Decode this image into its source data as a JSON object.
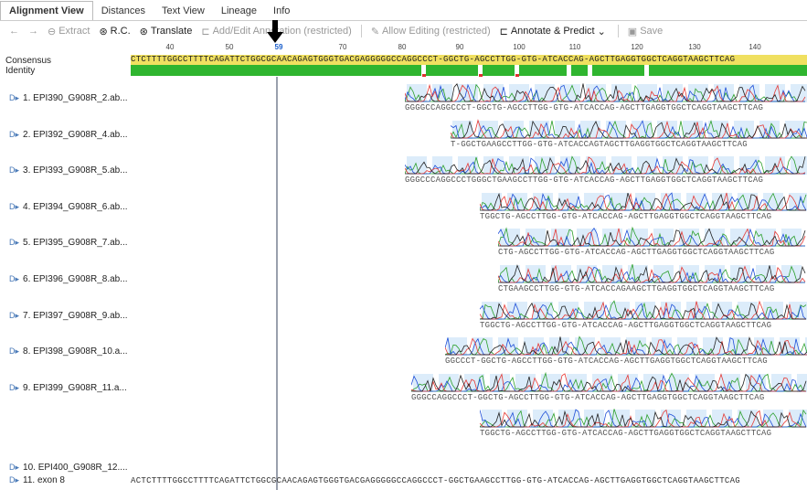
{
  "tabs": [
    {
      "label": "Alignment View",
      "active": true
    },
    {
      "label": "Distances"
    },
    {
      "label": "Text View"
    },
    {
      "label": "Lineage"
    },
    {
      "label": "Info"
    }
  ],
  "toolbar": {
    "back": "←",
    "forward": "→",
    "extract": "Extract",
    "rc": "R.C.",
    "translate": "Translate",
    "add_edit_annotation": "Add/Edit Annotation (restricted)",
    "allow_editing": "Allow Editing (restricted)",
    "annotate_predict": "Annotate & Predict",
    "save": "Save"
  },
  "ruler": {
    "ticks": [
      "40",
      "50",
      "59",
      "70",
      "80",
      "90",
      "100",
      "110",
      "120",
      "130",
      "140"
    ],
    "highlight": "59"
  },
  "header": {
    "consensus_label": "Consensus",
    "identity_label": "Identity",
    "consensus_seq": "CTCTTTTGGCCTTTTCAGATTCTGGCGCAACAGAGTGGGTGACGAGGGGGCCAGGCCCT-GGCTG-AGCCTTGG-GTG-ATCACCAG-AGCTTGAGGTGGCTCAGGTAAGCTTCAG"
  },
  "tracks": [
    {
      "label": "1. EPI390_G908R_2.ab...",
      "seq": "GGGGCCAGGCCCT-GGCTG-AGCCTTGG-GTG-ATCACCAG-AGCTTGAGGTGGCTCAGGTAAGCTTCAG"
    },
    {
      "label": "2. EPI392_G908R_4.ab...",
      "seq": "T-GGCTGAAGCCTTGG-GTG-ATCACCAGTAGCTTGAGGTGGCTCAGGTAAGCTTCAG"
    },
    {
      "label": "3. EPI393_G908R_5.ab...",
      "seq": "GGGCCCAGGCCCTGGGCTGAAGCCTTGG-GTG-ATCACCAG-AGCTTGAGGTGGCTCAGGTAAGCTTCAG"
    },
    {
      "label": "4. EPI394_G908R_6.ab...",
      "seq": "TGGCTG-AGCCTTGG-GTG-ATCACCAG-AGCTTGAGGTGGCTCAGGTAAGCTTCAG"
    },
    {
      "label": "5. EPI395_G908R_7.ab...",
      "seq": "CTG-AGCCTTGG-GTG-ATCACCAG-AGCTTGAGGTGGCTCAGGTAAGCTTCAG"
    },
    {
      "label": "6. EPI396_G908R_8.ab...",
      "seq": "CTGAAGCCTTGG-GTG-ATCACCAGAAGCTTGAGGTGGCTCAGGTAAGCTTCAG"
    },
    {
      "label": "7. EPI397_G908R_9.ab...",
      "seq": "TGGCTG-AGCCTTGG-GTG-ATCACCAG-AGCTTGAGGTGGCTCAGGTAAGCTTCAG"
    },
    {
      "label": "8. EPI398_G908R_10.a...",
      "seq": "GGCCCT-GGCTG-AGCCTTGG-GTG-ATCACCAG-AGCTTGAGGTGGCTCAGGTAAGCTTCAG"
    },
    {
      "label": "9. EPI399_G908R_11.a...",
      "seq": "GGGCCAGGCCCT-GGCTG-AGCCTTGG-GTG-ATCACCAG-AGCTTGAGGTGGCTCAGGTAAGCTTCAG"
    },
    {
      "label": "10. EPI400_G908R_12....",
      "seq": "TGGCTG-AGCCTTGG-GTG-ATCACCAG-AGCTTGAGGTGGCTCAGGTAAGCTTCAG"
    }
  ],
  "exon": {
    "label": "11. exon 8",
    "seq": "ACTCTTTTGGCCTTTTCAGATTCTGGCGCAACAGAGTGGGTGACGAGGGGGCCAGGCCCT-GGCTGAAGCCTTGG-GTG-ATCACCAG-AGCTTGAGGTGGCTCAGGTAAGCTTCAG"
  }
}
